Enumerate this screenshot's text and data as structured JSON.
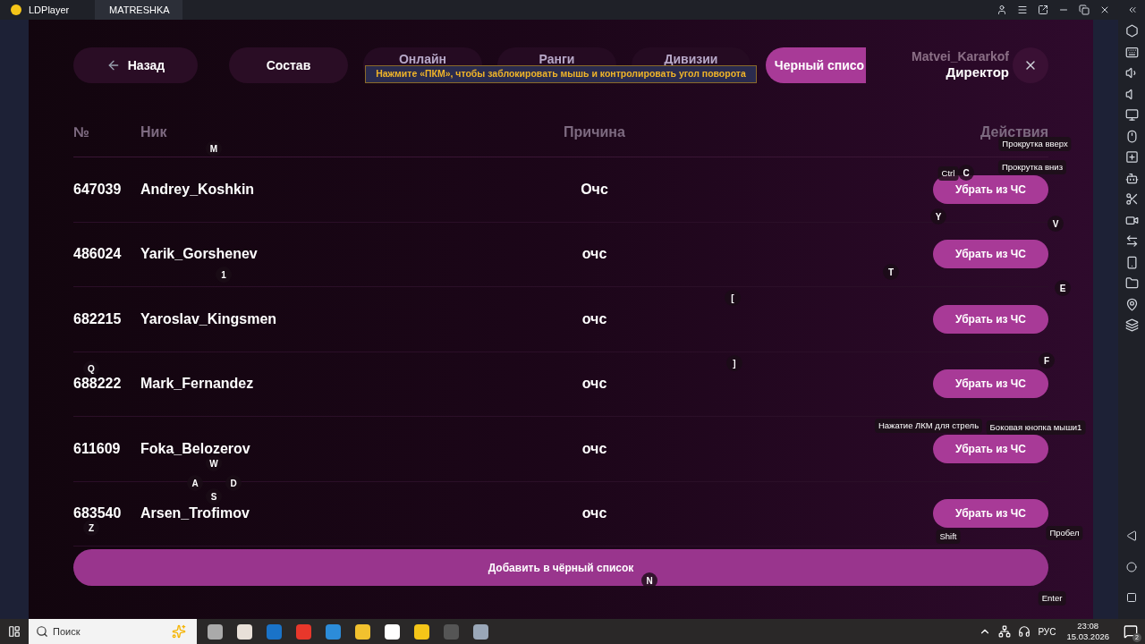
{
  "emulator": {
    "tabs": [
      {
        "label": "LDPlayer",
        "selected": false
      },
      {
        "label": "MATRESHKA",
        "selected": true
      }
    ]
  },
  "game": {
    "back": "Назад",
    "tabs": [
      {
        "label": "Состав",
        "selected": false
      },
      {
        "label": "Онлайн",
        "selected": false
      },
      {
        "label": "Ранги",
        "selected": false
      },
      {
        "label": "Дивизии",
        "selected": false
      },
      {
        "label": "Черный списо",
        "selected": true
      }
    ],
    "user": {
      "name": "Matvei_Kararkof",
      "role": "Директор"
    },
    "table": {
      "columns": [
        "№",
        "Ник",
        "Причина",
        "Действия"
      ],
      "rows": [
        {
          "number": "647039",
          "nick": "Andrey_Koshkin",
          "reason": "Очс",
          "action": "Убрать из ЧС"
        },
        {
          "number": "486024",
          "nick": "Yarik_Gorshenev",
          "reason": "очс",
          "action": "Убрать из ЧС"
        },
        {
          "number": "682215",
          "nick": "Yaroslav_Kingsmen",
          "reason": "очс",
          "action": "Убрать из ЧС"
        },
        {
          "number": "688222",
          "nick": "Mark_Fernandez",
          "reason": "очс",
          "action": "Убрать из ЧС"
        },
        {
          "number": "611609",
          "nick": "Foka_Belozerov",
          "reason": "очс",
          "action": "Убрать из ЧС"
        },
        {
          "number": "683540",
          "nick": "Arsen_Trofimov",
          "reason": "очс",
          "action": "Убрать из ЧС"
        }
      ]
    },
    "add_button": "Добавить в чёрный список"
  },
  "key_overlay": {
    "hint": "Нажмите «ПКМ», чтобы заблокировать мышь и контролировать угол поворота",
    "keys": [
      "M",
      "Прокрутка вверх",
      "Ctrl",
      "C",
      "Прокрутка вниз",
      "Y",
      "V",
      "1",
      "T",
      "[",
      "E",
      "Q",
      "]",
      "F",
      "Нажатие ЛКМ для стрель",
      "Боковая кнопка мыши1",
      "W",
      "A",
      "D",
      "S",
      "Z",
      "Shift",
      "Пробел",
      "N",
      "Enter"
    ]
  },
  "taskbar": {
    "search": {
      "placeholder": "Поиск"
    },
    "language": "РУС",
    "time": "23:08",
    "date": "15.03.2026",
    "notifications": "2"
  }
}
